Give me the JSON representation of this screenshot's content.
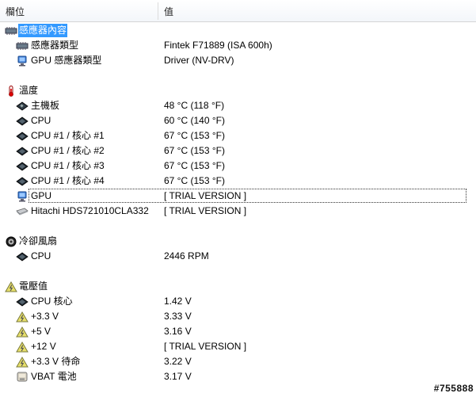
{
  "columns": {
    "field": "欄位",
    "value": "值"
  },
  "groups": [
    {
      "title": "感應器內容",
      "icon": "sensor-chip-icon",
      "selected": true,
      "items": [
        {
          "name": "感應器類型",
          "value": "Fintek F71889  (ISA 600h)",
          "icon": "sensor-chip-icon"
        },
        {
          "name": "GPU 感應器類型",
          "value": "Driver  (NV-DRV)",
          "icon": "monitor-icon"
        }
      ]
    },
    {
      "title": "溫度",
      "icon": "thermometer-icon",
      "items": [
        {
          "name": "主機板",
          "value": "48 °C  (118 °F)",
          "icon": "motherboard-icon"
        },
        {
          "name": "CPU",
          "value": "60 °C  (140 °F)",
          "icon": "cpu-chip-icon"
        },
        {
          "name": "CPU #1 / 核心 #1",
          "value": "67 °C  (153 °F)",
          "icon": "cpu-chip-icon"
        },
        {
          "name": "CPU #1 / 核心 #2",
          "value": "67 °C  (153 °F)",
          "icon": "cpu-chip-icon"
        },
        {
          "name": "CPU #1 / 核心 #3",
          "value": "67 °C  (153 °F)",
          "icon": "cpu-chip-icon"
        },
        {
          "name": "CPU #1 / 核心 #4",
          "value": "67 °C  (153 °F)",
          "icon": "cpu-chip-icon"
        },
        {
          "name": "GPU",
          "value": "[ TRIAL VERSION ]",
          "icon": "monitor-icon",
          "focused": true
        },
        {
          "name": "Hitachi HDS721010CLA332",
          "value": "[ TRIAL VERSION ]",
          "icon": "hard-drive-icon"
        }
      ]
    },
    {
      "title": "冷卻風扇",
      "icon": "fan-icon",
      "items": [
        {
          "name": "CPU",
          "value": "2446 RPM",
          "icon": "cpu-chip-icon"
        }
      ]
    },
    {
      "title": "電壓值",
      "icon": "voltage-warning-icon",
      "items": [
        {
          "name": "CPU 核心",
          "value": "1.42 V",
          "icon": "cpu-chip-icon"
        },
        {
          "name": "+3.3 V",
          "value": "3.33 V",
          "icon": "voltage-warning-icon"
        },
        {
          "name": "+5 V",
          "value": "3.16 V",
          "icon": "voltage-warning-icon"
        },
        {
          "name": "+12 V",
          "value": "[ TRIAL VERSION ]",
          "icon": "voltage-warning-icon"
        },
        {
          "name": "+3.3 V 待命",
          "value": "3.22 V",
          "icon": "voltage-warning-icon"
        },
        {
          "name": "VBAT 電池",
          "value": "3.17 V",
          "icon": "battery-icon"
        }
      ]
    }
  ],
  "watermark": "#755888"
}
